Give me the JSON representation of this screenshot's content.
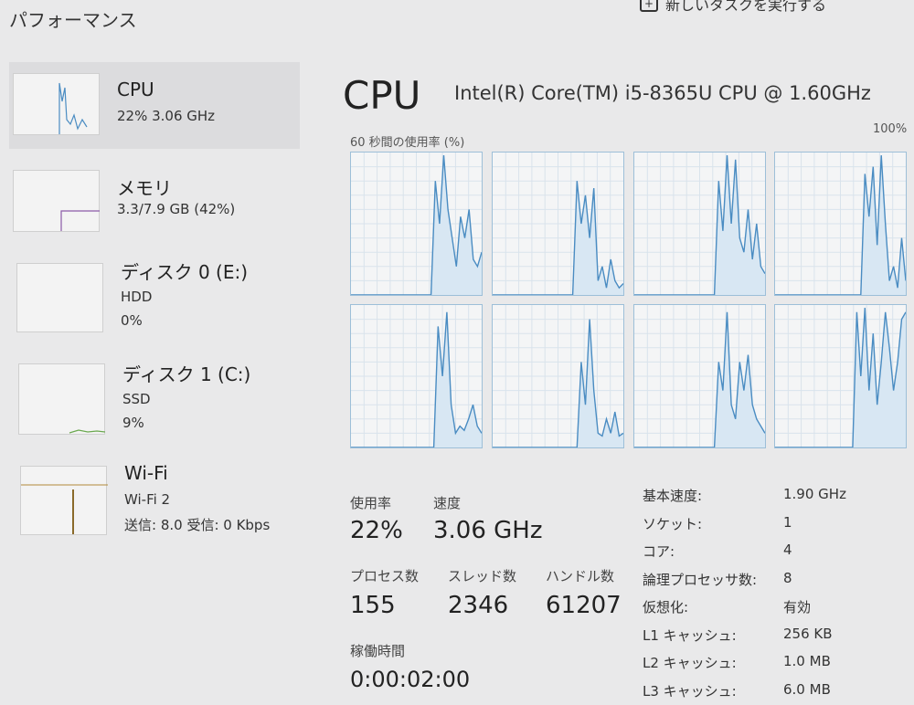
{
  "header": {
    "title": "パフォーマンス",
    "new_task": "新しいタスクを実行する"
  },
  "sidebar": {
    "items": [
      {
        "name": "CPU",
        "line1": "22% 3.06 GHz"
      },
      {
        "name": "メモリ",
        "line1": "3.3/7.9 GB (42%)"
      },
      {
        "name": "ディスク 0 (E:)",
        "line1": "HDD",
        "line2": "0%"
      },
      {
        "name": "ディスク 1 (C:)",
        "line1": "SSD",
        "line2": "9%"
      },
      {
        "name": "Wi-Fi",
        "line1": "Wi-Fi 2",
        "line2": "送信: 8.0 受信: 0 Kbps"
      }
    ]
  },
  "main": {
    "heading": "CPU",
    "model": "Intel(R) Core(TM) i5-8365U CPU @ 1.60GHz",
    "graph_label": "60 秒間の使用率 (%)",
    "graph_max": "100%",
    "accent": "#4a8cc2",
    "stats": {
      "usage_label": "使用率",
      "usage": "22%",
      "speed_label": "速度",
      "speed": "3.06 GHz",
      "processes_label": "プロセス数",
      "processes": "155",
      "threads_label": "スレッド数",
      "threads": "2346",
      "handles_label": "ハンドル数",
      "handles": "61207",
      "uptime_label": "稼働時間",
      "uptime": "0:00:02:00"
    },
    "specs": [
      {
        "k": "基本速度:",
        "v": "1.90 GHz"
      },
      {
        "k": "ソケット:",
        "v": "1"
      },
      {
        "k": "コア:",
        "v": "4"
      },
      {
        "k": "論理プロセッサ数:",
        "v": "8"
      },
      {
        "k": "仮想化:",
        "v": "有効"
      },
      {
        "k": "L1 キャッシュ:",
        "v": "256 KB"
      },
      {
        "k": "L2 キャッシュ:",
        "v": "1.0 MB"
      },
      {
        "k": "L3 キャッシュ:",
        "v": "6.0 MB"
      }
    ],
    "core_usage": [
      [
        0,
        0,
        0,
        0,
        0,
        0,
        0,
        0,
        0,
        0,
        0,
        0,
        0,
        0,
        0,
        0,
        0,
        0,
        0,
        0,
        80,
        50,
        98,
        60,
        40,
        20,
        55,
        40,
        60,
        25,
        20,
        30
      ],
      [
        0,
        0,
        0,
        0,
        0,
        0,
        0,
        0,
        0,
        0,
        0,
        0,
        0,
        0,
        0,
        0,
        0,
        0,
        0,
        0,
        80,
        50,
        70,
        40,
        75,
        10,
        20,
        5,
        25,
        10,
        5,
        8
      ],
      [
        0,
        0,
        0,
        0,
        0,
        0,
        0,
        0,
        0,
        0,
        0,
        0,
        0,
        0,
        0,
        0,
        0,
        0,
        0,
        0,
        80,
        45,
        98,
        50,
        95,
        40,
        30,
        60,
        25,
        50,
        20,
        15
      ],
      [
        0,
        0,
        0,
        0,
        0,
        0,
        0,
        0,
        0,
        0,
        0,
        0,
        0,
        0,
        0,
        0,
        0,
        0,
        0,
        0,
        0,
        0,
        85,
        55,
        90,
        35,
        98,
        50,
        10,
        20,
        5,
        40,
        10
      ],
      [
        0,
        0,
        0,
        0,
        0,
        0,
        0,
        0,
        0,
        0,
        0,
        0,
        0,
        0,
        0,
        0,
        0,
        0,
        0,
        0,
        85,
        50,
        95,
        30,
        10,
        15,
        12,
        20,
        30,
        15,
        10
      ],
      [
        0,
        0,
        0,
        0,
        0,
        0,
        0,
        0,
        0,
        0,
        0,
        0,
        0,
        0,
        0,
        0,
        0,
        0,
        0,
        0,
        0,
        60,
        30,
        90,
        40,
        10,
        8,
        20,
        10,
        25,
        8,
        10
      ],
      [
        0,
        0,
        0,
        0,
        0,
        0,
        0,
        0,
        0,
        0,
        0,
        0,
        0,
        0,
        0,
        0,
        0,
        0,
        0,
        0,
        60,
        40,
        95,
        30,
        20,
        60,
        40,
        65,
        30,
        20,
        15,
        10
      ],
      [
        0,
        0,
        0,
        0,
        0,
        0,
        0,
        0,
        0,
        0,
        0,
        0,
        0,
        0,
        0,
        0,
        0,
        0,
        0,
        0,
        95,
        50,
        98,
        40,
        80,
        30,
        60,
        95,
        70,
        40,
        60,
        90,
        95
      ]
    ]
  }
}
